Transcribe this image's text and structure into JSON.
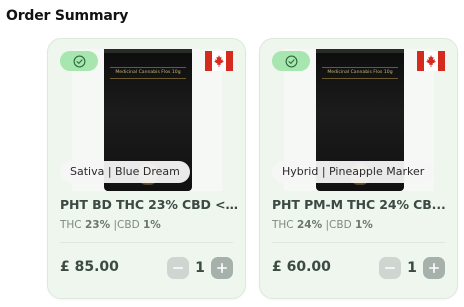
{
  "section": {
    "title": "Order Summary"
  },
  "products": [
    {
      "image_label": "Medicinal Cannabis Flos 10g",
      "strain": "Sativa | Blue Dream",
      "name": "PHT BD THC 23% CBD <1...",
      "thc_label": "THC",
      "thc_value": "23%",
      "separator": "|",
      "cbd_label": "CBD",
      "cbd_value": "1%",
      "price": "£ 85.00",
      "quantity": "1"
    },
    {
      "image_label": "Medicinal Cannabis Flos 10g",
      "strain": "Hybrid | Pineapple Marker",
      "name": "PHT PM-M THC 24% CB...",
      "thc_label": "THC",
      "thc_value": "24%",
      "separator": "|",
      "cbd_label": "CBD",
      "cbd_value": "1%",
      "price": "£ 60.00",
      "quantity": "1"
    }
  ],
  "icons": {
    "verified": "check-circle-icon",
    "origin_flag": "canada-flag-icon",
    "decrement": "minus-icon",
    "increment": "plus-icon"
  },
  "colors": {
    "card_bg": "#eef6ee",
    "badge_green": "#a8e6b0",
    "flag_red": "#d52b1e"
  }
}
